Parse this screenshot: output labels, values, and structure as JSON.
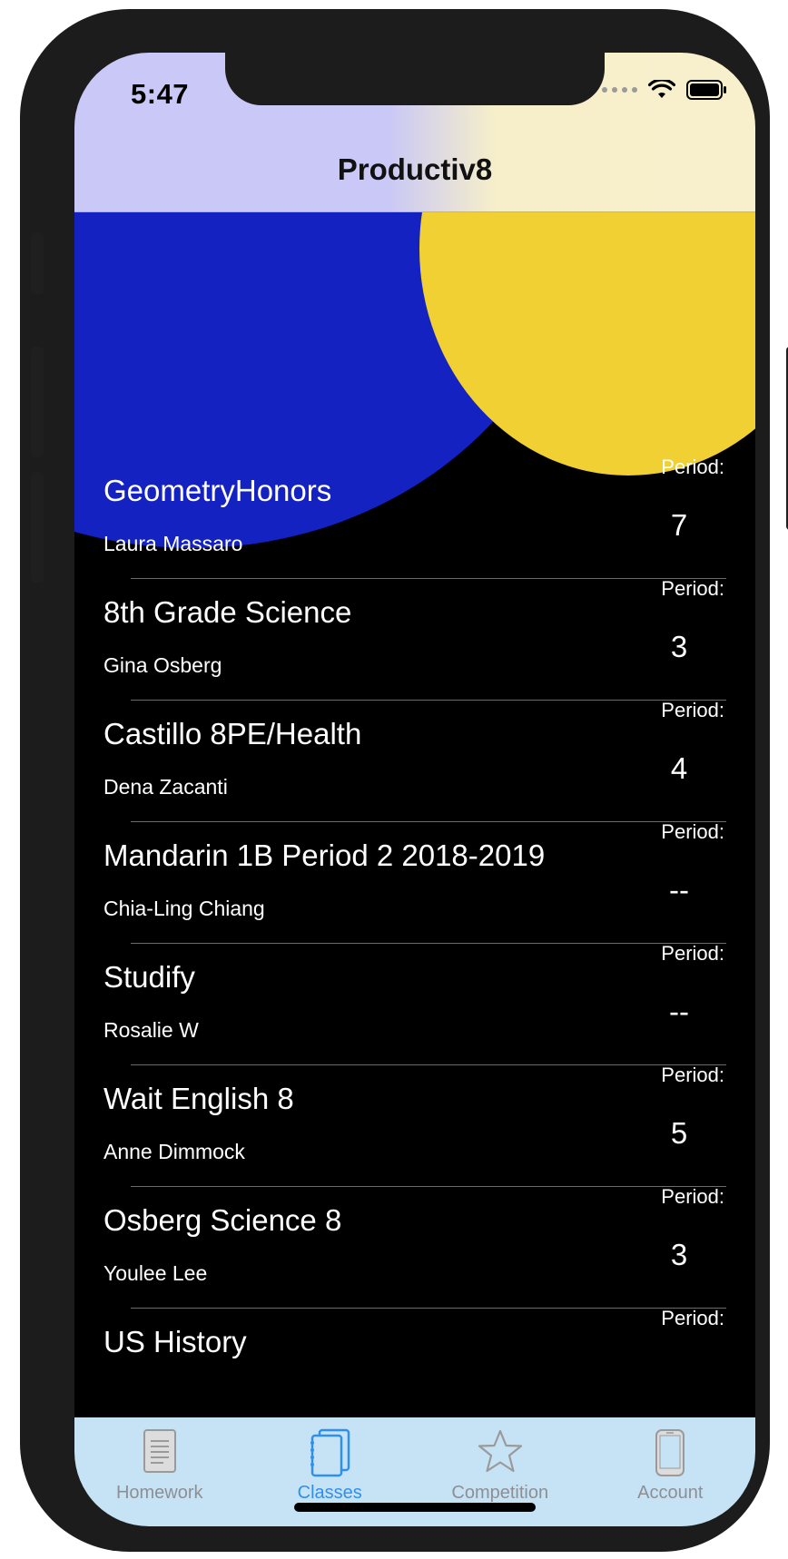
{
  "status_bar": {
    "time": "5:47"
  },
  "nav": {
    "title": "Productiv8"
  },
  "classes": [
    {
      "name": "GeometryHonors",
      "teacher": "Laura Massaro",
      "period_label": "Period:",
      "period": "7"
    },
    {
      "name": "8th Grade Science",
      "teacher": "Gina Osberg",
      "period_label": "Period:",
      "period": "3"
    },
    {
      "name": "Castillo 8PE/Health",
      "teacher": "Dena Zacanti",
      "period_label": "Period:",
      "period": "4"
    },
    {
      "name": "Mandarin 1B Period 2 2018-2019",
      "teacher": "Chia-Ling Chiang",
      "period_label": "Period:",
      "period": "--"
    },
    {
      "name": "Studify",
      "teacher": "Rosalie W",
      "period_label": "Period:",
      "period": "--"
    },
    {
      "name": "Wait English 8",
      "teacher": "Anne Dimmock",
      "period_label": "Period:",
      "period": "5"
    },
    {
      "name": "Osberg Science 8",
      "teacher": "Youlee Lee",
      "period_label": "Period:",
      "period": "3"
    },
    {
      "name": "US History",
      "teacher": "",
      "period_label": "Period:",
      "period": ""
    }
  ],
  "tabs": [
    {
      "label": "Homework",
      "icon": "document-icon",
      "active": false
    },
    {
      "label": "Classes",
      "icon": "notebooks-icon",
      "active": true
    },
    {
      "label": "Competition",
      "icon": "star-icon",
      "active": false
    },
    {
      "label": "Account",
      "icon": "phone-icon",
      "active": false
    }
  ],
  "colors": {
    "header_left": "#c9c8f6",
    "header_right": "#f8efcd",
    "blob_blue": "#1322c0",
    "blob_yellow": "#f0d032",
    "tabbar_bg": "#c6e3f5",
    "tab_active": "#2f8ff0",
    "tab_inactive": "#8e8e93"
  }
}
